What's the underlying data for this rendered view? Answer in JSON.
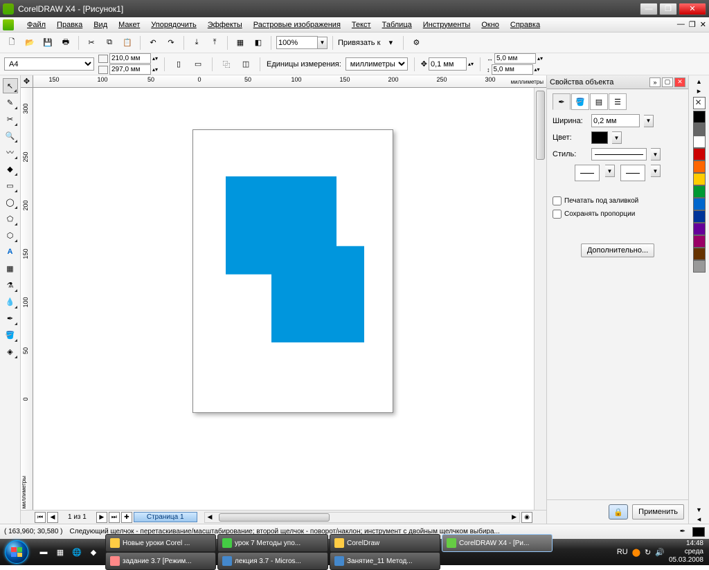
{
  "window": {
    "title": "CorelDRAW X4 - [Рисунок1]"
  },
  "menu": [
    "Файл",
    "Правка",
    "Вид",
    "Макет",
    "Упорядочить",
    "Эффекты",
    "Растровые изображения",
    "Текст",
    "Таблица",
    "Инструменты",
    "Окно",
    "Справка"
  ],
  "toolbar1": {
    "zoom": "100%",
    "snap_label": "Привязать к"
  },
  "propbar": {
    "pagesize": "А4",
    "width": "210,0 мм",
    "height": "297,0 мм",
    "units_label": "Единицы измерения:",
    "units": "миллиметры",
    "nudge": "0,1 мм",
    "dup_x": "5,0 мм",
    "dup_y": "5,0 мм"
  },
  "ruler": {
    "h_labels": [
      "150",
      "100",
      "50",
      "0",
      "50",
      "100",
      "150",
      "200",
      "250",
      "300"
    ],
    "h_unit": "миллиметры",
    "v_labels": [
      "300",
      "250",
      "200",
      "150",
      "100",
      "50",
      "0"
    ],
    "v_unit": "миллиметры"
  },
  "page_nav": {
    "counter": "1 из 1",
    "tab": "Страница 1"
  },
  "docker": {
    "title": "Свойства объекта",
    "width_label": "Ширина:",
    "width_val": "0,2 мм",
    "color_label": "Цвет:",
    "style_label": "Стиль:",
    "print_behind": "Печатать под заливкой",
    "keep_prop": "Сохранять пропорции",
    "advanced": "Дополнительно...",
    "apply": "Применить"
  },
  "status": {
    "coords": "( 163,960; 30,580 )",
    "hint": "Следующий щелчок - перетаскивание/масштабирование; второй щелчок - поворот/наклон; инструмент с двойным щелчком выбира..."
  },
  "colors": [
    "#000000",
    "#666666",
    "#ffffff",
    "#cc0000",
    "#ff6600",
    "#ffcc00",
    "#009933",
    "#0066cc",
    "#003399",
    "#660099",
    "#990066",
    "#663300",
    "#999999"
  ],
  "taskbar": {
    "tasks_row1": [
      "Новые уроки Corel ...",
      "урок 7 Методы упо...",
      "CorelDraw",
      "CorelDRAW X4 - [Ри..."
    ],
    "tasks_row2": [
      "задание 3.7 [Режим...",
      "лекция 3.7 - Micros...",
      "Занятие_11 Метод..."
    ],
    "lang": "RU",
    "time": "14:48",
    "day": "среда",
    "date": "05.03.2008"
  }
}
